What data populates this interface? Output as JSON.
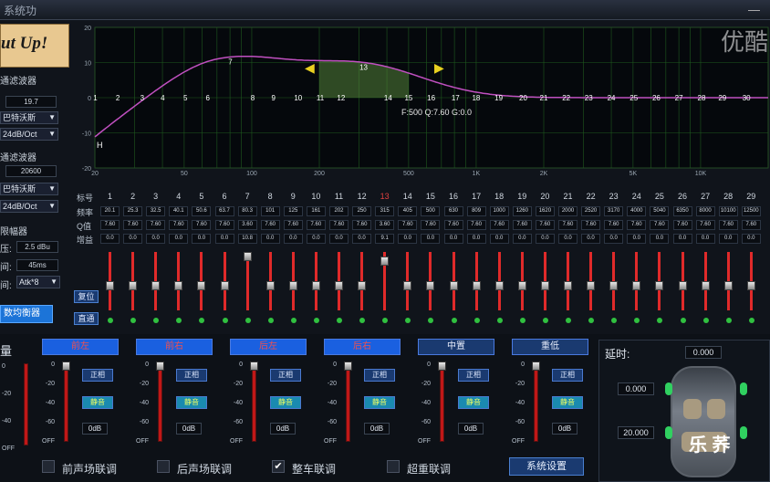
{
  "window": {
    "title": "系统功",
    "close": "—"
  },
  "logo": {
    "text": "ut Up!"
  },
  "left": {
    "hp_label": "通滤波器",
    "hp_freq": "19.7",
    "hp_type": "巴特沃斯",
    "hp_slope": "24dB/Oct",
    "lp_label": "通滤波器",
    "lp_freq": "20600",
    "lp_type": "巴特沃斯",
    "lp_slope": "24dB/Oct",
    "limiter_label": "限幅器",
    "gain_label": "压:",
    "gain_value": "2.5 dBu",
    "attack_label": "间:",
    "attack_value": "45ms",
    "release_label": "间:",
    "release_value": "Atk*8",
    "eq_button": "数均衡器"
  },
  "graph": {
    "x_ticks": [
      "20",
      "50",
      "100",
      "200",
      "500",
      "1K",
      "2K",
      "5K",
      "10K"
    ],
    "y_ticks": [
      "20",
      "10",
      "0",
      "-10",
      "-20"
    ],
    "band_markers": [
      "1",
      "2",
      "3",
      "4",
      "5",
      "6",
      "7",
      "8",
      "9",
      "10",
      "11",
      "12",
      "13",
      "14",
      "15",
      "16",
      "17",
      "18",
      "19",
      "20",
      "21",
      "22",
      "23",
      "24",
      "25",
      "26",
      "27",
      "28",
      "29",
      "30"
    ],
    "info": "F:500 Q:7.60 G:0.0",
    "h_marker": "H",
    "prev_arrow": "◀",
    "next_arrow": "▶",
    "watermark": "优酷"
  },
  "bands": {
    "row_labels": {
      "num": "标号",
      "freq": "频率",
      "q": "Q值",
      "gain": "增益"
    },
    "nums": [
      "1",
      "2",
      "3",
      "4",
      "5",
      "6",
      "7",
      "8",
      "9",
      "10",
      "11",
      "12",
      "13",
      "14",
      "15",
      "16",
      "17",
      "18",
      "19",
      "20",
      "21",
      "22",
      "23",
      "24",
      "25",
      "26",
      "27",
      "28",
      "29"
    ],
    "freqs": [
      "20.1",
      "25.3",
      "32.5",
      "40.1",
      "50.6",
      "63.7",
      "80.3",
      "101",
      "125",
      "161",
      "202",
      "250",
      "315",
      "405",
      "500",
      "630",
      "809",
      "1000",
      "1260",
      "1620",
      "2000",
      "2520",
      "3170",
      "4000",
      "5040",
      "6350",
      "8000",
      "10100",
      "12500"
    ],
    "q": [
      "7.60",
      "7.60",
      "7.60",
      "7.60",
      "7.60",
      "7.60",
      "3.60",
      "7.60",
      "7.60",
      "7.60",
      "7.60",
      "7.60",
      "3.60",
      "7.60",
      "7.60",
      "7.60",
      "7.60",
      "7.60",
      "7.60",
      "7.60",
      "7.60",
      "7.60",
      "7.60",
      "7.60",
      "7.60",
      "7.60",
      "7.60",
      "7.60",
      "7.60"
    ],
    "gains": [
      "0.0",
      "0.0",
      "0.0",
      "0.0",
      "0.0",
      "0.0",
      "10.8",
      "0.0",
      "0.0",
      "0.0",
      "0.0",
      "0.0",
      "9.1",
      "0.0",
      "0.0",
      "0.0",
      "0.0",
      "0.0",
      "0.0",
      "0.0",
      "0.0",
      "0.0",
      "0.0",
      "0.0",
      "0.0",
      "0.0",
      "0.0",
      "0.0",
      "0.0"
    ],
    "selected": "13",
    "reset_button": "复位",
    "bypass_button": "直通"
  },
  "bottom": {
    "volume_label": "量",
    "vol_scale": [
      "0",
      "-20",
      "-40",
      "OFF"
    ],
    "ch_scale": [
      "0",
      "-20",
      "-40",
      "-60",
      "OFF"
    ],
    "channels": [
      {
        "name": "前左",
        "phase": "正相",
        "mute": "静音",
        "db": "0dB"
      },
      {
        "name": "前右",
        "phase": "正相",
        "mute": "静音",
        "db": "0dB"
      },
      {
        "name": "后左",
        "phase": "正相",
        "mute": "静音",
        "db": "0dB"
      },
      {
        "name": "后右",
        "phase": "正相",
        "mute": "静音",
        "db": "0dB"
      },
      {
        "name": "中置",
        "phase": "正相",
        "mute": "静音",
        "db": "0dB"
      },
      {
        "name": "重低",
        "phase": "正相",
        "mute": "静音",
        "db": "0dB"
      }
    ],
    "checks": [
      {
        "label": "前声场联调",
        "checked": false
      },
      {
        "label": "后声场联调",
        "checked": false
      },
      {
        "label": "整车联调",
        "checked": true
      },
      {
        "label": "超重联调",
        "checked": false
      }
    ],
    "settings_button": "系统设置"
  },
  "delay": {
    "label": "延时:",
    "top": "0.000",
    "left": "0.000",
    "bottom": "20.000",
    "brand": "乐 荞"
  }
}
